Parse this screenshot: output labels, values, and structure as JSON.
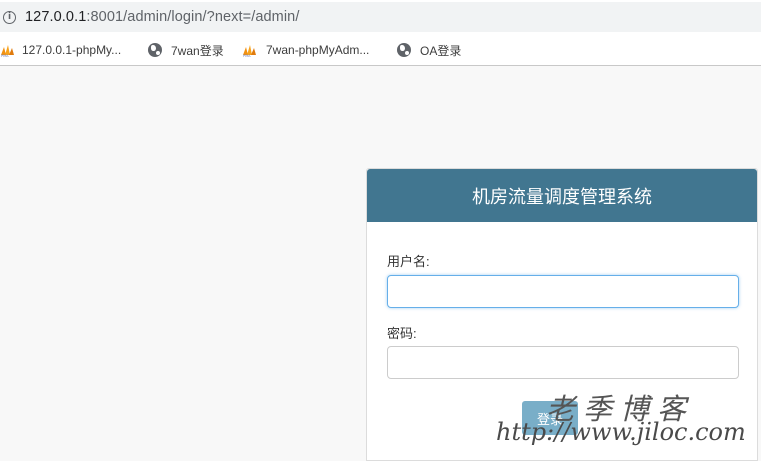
{
  "browser": {
    "url_host": "127.0.0.1",
    "url_path": ":8001/admin/login/?next=/admin/",
    "info_icon": "info-icon"
  },
  "bookmarks": [
    {
      "label": "127.0.0.1-phpMy...",
      "icon": "phpmyadmin-icon"
    },
    {
      "label": "7wan登录",
      "icon": "globe-icon"
    },
    {
      "label": "7wan-phpMyAdm...",
      "icon": "phpmyadmin-icon"
    },
    {
      "label": "OA登录",
      "icon": "globe-icon"
    }
  ],
  "login": {
    "title": "机房流量调度管理系统",
    "username_label": "用户名:",
    "username_value": "",
    "password_label": "密码:",
    "password_value": "",
    "submit_label": "登录"
  },
  "watermark": {
    "cn": "老季博客",
    "url": "http://www.jiloc.com"
  },
  "colors": {
    "header_bg": "#417690",
    "button_bg": "#79aec8",
    "page_bg": "#f8f8f8"
  }
}
